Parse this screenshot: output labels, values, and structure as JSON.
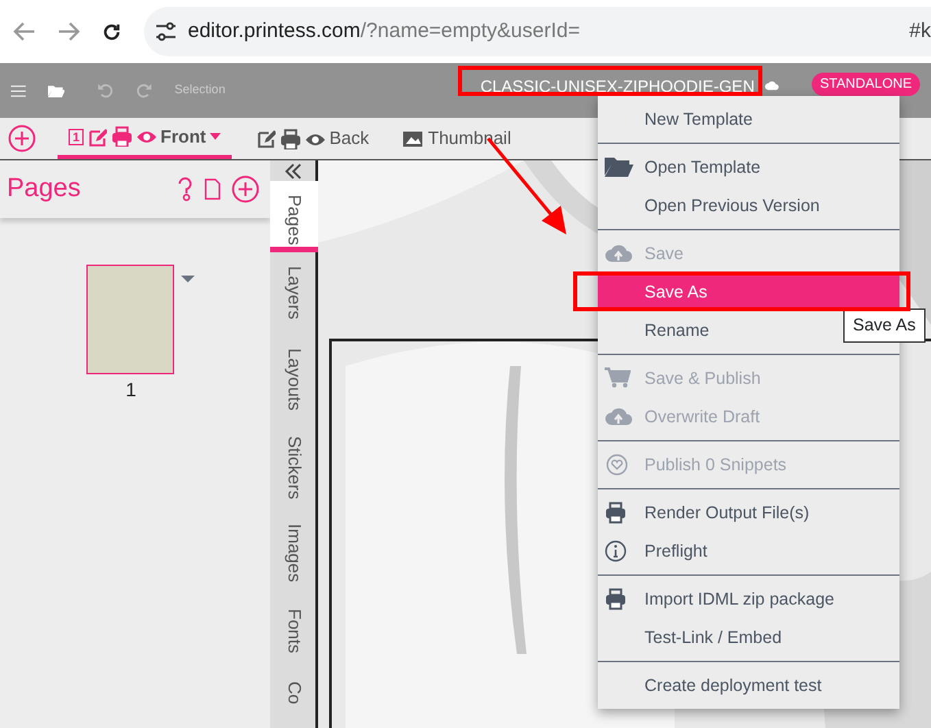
{
  "browser": {
    "url_host": "editor.printess.com",
    "url_path": "/?name=empty&userId=",
    "url_tail": "#k"
  },
  "toolbar": {
    "selection_label": "Selection",
    "template_title": "CLASSIC-UNISEX-ZIPHOODIE-GEN",
    "mode_badge": "STANDALONE"
  },
  "doc_tabs": [
    {
      "label": "Front",
      "page_number": "1",
      "selected": true
    },
    {
      "label": "Back",
      "selected": false
    },
    {
      "label": "Thumbnail",
      "selected": false
    }
  ],
  "pages_panel": {
    "title": "Pages",
    "pages": [
      {
        "label": "1"
      }
    ]
  },
  "side_tabs": [
    {
      "label": "Pages",
      "selected": true
    },
    {
      "label": "Layers",
      "selected": false
    },
    {
      "label": "Layouts",
      "selected": false
    },
    {
      "label": "Stickers",
      "selected": false
    },
    {
      "label": "Images",
      "selected": false
    },
    {
      "label": "Fonts",
      "selected": false
    },
    {
      "label": "Co",
      "selected": false
    }
  ],
  "menu": [
    [
      {
        "label": "New Template",
        "disabled": false,
        "selected": false
      }
    ],
    [
      {
        "label": "Open Template",
        "disabled": false,
        "selected": false
      },
      {
        "label": "Open Previous Version",
        "disabled": false,
        "selected": false
      }
    ],
    [
      {
        "label": "Save",
        "disabled": true,
        "selected": false
      },
      {
        "label": "Save As",
        "disabled": false,
        "selected": true
      },
      {
        "label": "Rename",
        "disabled": false,
        "selected": false
      }
    ],
    [
      {
        "label": "Save & Publish",
        "disabled": true,
        "selected": false
      },
      {
        "label": "Overwrite Draft",
        "disabled": true,
        "selected": false
      }
    ],
    [
      {
        "label": "Publish 0 Snippets",
        "disabled": true,
        "selected": false
      }
    ],
    [
      {
        "label": "Render Output File(s)",
        "disabled": false,
        "selected": false
      },
      {
        "label": "Preflight",
        "disabled": false,
        "selected": false
      }
    ],
    [
      {
        "label": "Import IDML zip package",
        "disabled": false,
        "selected": false
      },
      {
        "label": "Test-Link / Embed",
        "disabled": false,
        "selected": false
      }
    ],
    [
      {
        "label": "Create deployment test",
        "disabled": false,
        "selected": false
      }
    ]
  ],
  "tooltip": "Save As"
}
